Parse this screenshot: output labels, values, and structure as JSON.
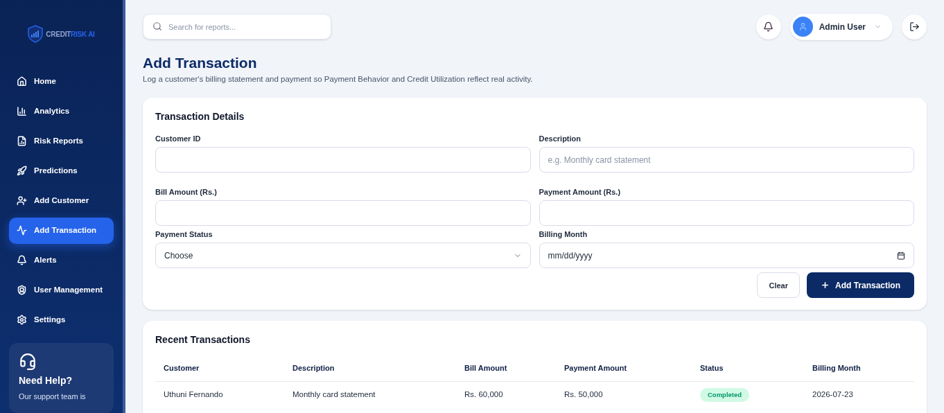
{
  "sidebar": {
    "logo": {
      "word_1": "CREDIT",
      "word_2": "RISK AI"
    },
    "items": [
      {
        "label": "Home",
        "selected": false
      },
      {
        "label": "Analytics",
        "selected": false
      },
      {
        "label": "Risk Reports",
        "selected": false
      },
      {
        "label": "Predictions",
        "selected": false
      },
      {
        "label": "Add Customer",
        "selected": false
      },
      {
        "label": "Add Transaction",
        "selected": true
      },
      {
        "label": "Alerts",
        "selected": false
      },
      {
        "label": "User Management",
        "selected": false
      },
      {
        "label": "Settings",
        "selected": false
      }
    ],
    "help": {
      "title": "Need Help?",
      "text": "Our support team is"
    }
  },
  "header": {
    "search": {
      "placeholder": "Search for reports..."
    },
    "user": {
      "name": "Admin User"
    }
  },
  "page": {
    "title": "Add Transaction",
    "subtitle": "Log a customer's billing statement and payment so Payment Behavior and Credit Utilization reflect real activity."
  },
  "form": {
    "title": "Transaction Details",
    "fields": [
      {
        "label": "Customer ID",
        "kind": "text"
      },
      {
        "label": "Description",
        "kind": "text",
        "placeholder": "e.g. Monthly card statement"
      },
      {
        "label": "Bill Amount (Rs.)",
        "kind": "text"
      },
      {
        "label": "Payment Amount (Rs.)",
        "kind": "text"
      },
      {
        "label": "Payment Status",
        "kind": "select",
        "value": "Choose"
      },
      {
        "label": "Billing Month",
        "kind": "date",
        "value": "mm/dd/yyyy"
      }
    ],
    "buttons": {
      "clear": "Clear",
      "submit": "Add Transaction"
    }
  },
  "table": {
    "title": "Recent Transactions",
    "columns": [
      "Customer",
      "Description",
      "Bill Amount",
      "Payment Amount",
      "Status",
      "Billing Month"
    ],
    "rows": [
      {
        "customer": "Uthuni Fernando",
        "description": "Monthly card statement",
        "bill": "Rs. 60,000",
        "payment": "Rs. 50,000",
        "status": "Completed",
        "month": "2026-07-23"
      }
    ]
  }
}
